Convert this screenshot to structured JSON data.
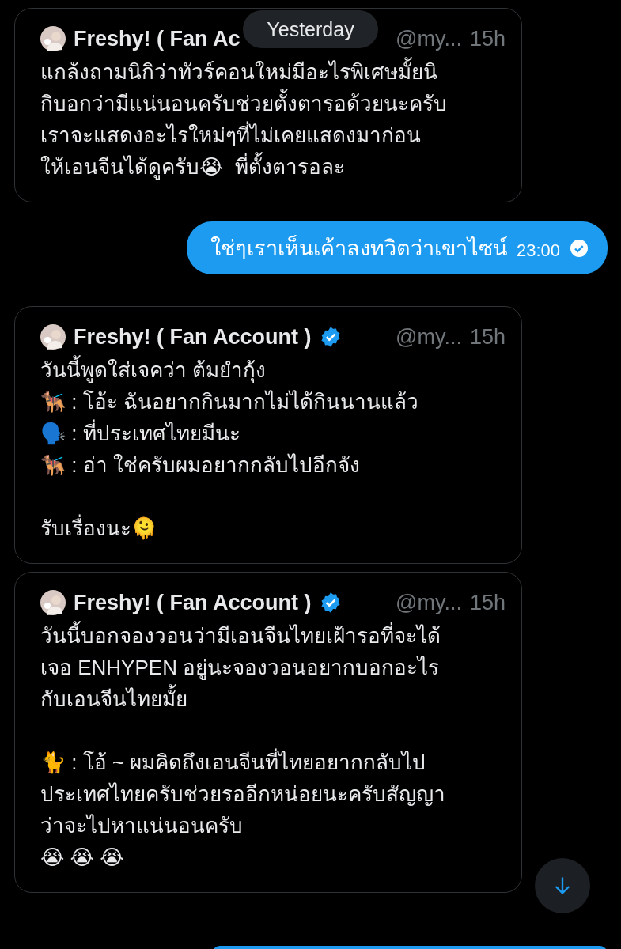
{
  "date_separator": "Yesterday",
  "messages": [
    {
      "kind": "quote",
      "name": "Freshy! ( Fan Ac",
      "verified": false,
      "handle": "@my...",
      "time": "15h",
      "text": "แกล้งถามนิกิว่าทัวร์คอนใหม่มีอะไรพิเศษมั้ยนิ\nกิบอกว่ามีแน่นอนครับช่วยตั้งตารอด้วยนะครับ\nเราจะแสดงอะไรใหม่ๆที่ไม่เคยแสดงมาก่อน\nให้เอนจีนได้ดูครับ😭  พี่ตั้งตารอละ"
    },
    {
      "kind": "sent",
      "text": "ใช่ๆเราเห็นเค้าลงทวิตว่าเขาไซน์",
      "time": "23:00",
      "read": true
    },
    {
      "kind": "quote",
      "name": "Freshy! ( Fan Account )",
      "verified": true,
      "handle": "@my...",
      "time": "15h",
      "text": "วันนี้พูดใส่เจคว่า ต้มยำกุ้ง\n🐕‍🦺 : โอ้ะ ฉันอยากกินมากไม่ได้กินนานแล้ว\n🗣️ : ที่ประเทศไทยมีนะ\n🐕‍🦺 : อ่า ใช่ครับผมอยากกลับไปอีกจัง\n\nรับเรื่องนะ🫠"
    },
    {
      "kind": "quote",
      "name": "Freshy! ( Fan Account )",
      "verified": true,
      "handle": "@my...",
      "time": "15h",
      "text": "วันนี้บอกจองวอนว่ามีเอนจีนไทยเฝ้ารอที่จะได้\nเจอ ENHYPEN อยู่นะจองวอนอยากบอกอะไร\nกับเอนจีนไทยมั้ย\n\n🐈 : โอ้ ~ ผมคิดถึงเอนจีนที่ไทยอยากกลับไป\nประเทศไทยครับช่วยรออีกหน่อยนะครับสัญญา\nว่าจะไปหาแน่นอนครับ\n😭 😭 😭"
    }
  ]
}
